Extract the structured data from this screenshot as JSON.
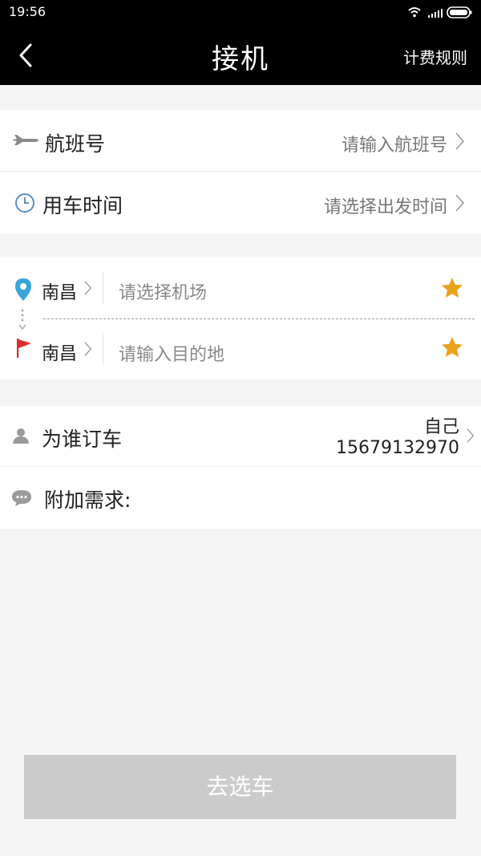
{
  "status_bar": {
    "time": "19:56"
  },
  "nav": {
    "title": "接机",
    "rules_label": "计费规则"
  },
  "flight": {
    "label": "航班号",
    "placeholder": "请输入航班号"
  },
  "time_row": {
    "label": "用车时间",
    "placeholder": "请选择出发时间"
  },
  "route": {
    "pickup": {
      "city": "南昌",
      "placeholder": "请选择机场"
    },
    "dropoff": {
      "city": "南昌",
      "placeholder": "请输入目的地"
    }
  },
  "booker": {
    "label": "为谁订车",
    "name": "自己",
    "phone": "15679132970"
  },
  "extra": {
    "label": "附加需求:"
  },
  "submit": {
    "label": "去选车"
  },
  "colors": {
    "star": "#e8a21c",
    "pin": "#3aa5d6",
    "flag": "#e02b2b",
    "button_disabled": "#cbcbcb"
  }
}
